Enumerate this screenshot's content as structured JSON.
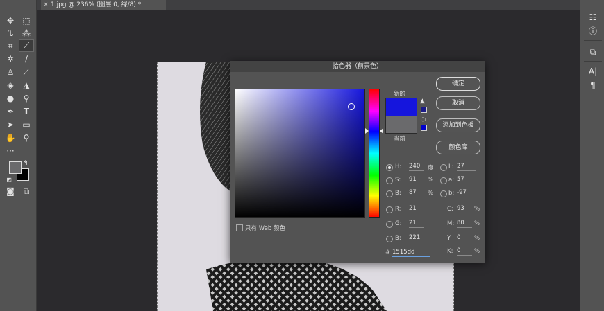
{
  "document_tab": {
    "title": "1.jpg @ 236% (图层 0, 绿/8) *",
    "close_glyph": "×"
  },
  "dialog": {
    "title": "拾色器（前景色）",
    "new_label": "新的",
    "current_label": "当前",
    "buttons": {
      "ok": "确定",
      "cancel": "取消",
      "add_swatch": "添加到色板",
      "libraries": "颜色库"
    },
    "web_only_label": "只有 Web 颜色",
    "new_color": "#1515dd",
    "current_color": "#6a6a6c",
    "hsb": {
      "h": {
        "label": "H:",
        "value": "240",
        "unit": "度"
      },
      "s": {
        "label": "S:",
        "value": "91",
        "unit": "%"
      },
      "b": {
        "label": "B:",
        "value": "87",
        "unit": "%"
      }
    },
    "rgb": {
      "r": {
        "label": "R:",
        "value": "21"
      },
      "g": {
        "label": "G:",
        "value": "21"
      },
      "b": {
        "label": "B:",
        "value": "221"
      }
    },
    "lab": {
      "l": {
        "label": "L:",
        "value": "27"
      },
      "a": {
        "label": "a:",
        "value": "57"
      },
      "b": {
        "label": "b:",
        "value": "-97"
      }
    },
    "cmyk": {
      "c": {
        "label": "C:",
        "value": "93",
        "unit": "%"
      },
      "m": {
        "label": "M:",
        "value": "80",
        "unit": "%"
      },
      "y": {
        "label": "Y:",
        "value": "0",
        "unit": "%"
      },
      "k": {
        "label": "K:",
        "value": "0",
        "unit": "%"
      }
    },
    "hex": {
      "label": "#",
      "value": "1515dd"
    }
  },
  "toolbar": {
    "tools": [
      "move-icon",
      "artboard-icon",
      "lasso-icon",
      "magic-wand-icon",
      "crop-icon",
      "eyedropper-icon",
      "healing-icon",
      "brush-icon",
      "stamp-icon",
      "history-brush-icon",
      "eraser-icon",
      "paint-bucket-icon",
      "blur-icon",
      "dodge-icon",
      "pen-icon",
      "text-icon",
      "path-select-icon",
      "rectangle-icon",
      "hand-icon",
      "zoom-icon",
      "more-icon"
    ],
    "foreground": "#6a6a6c",
    "background": "#000000"
  },
  "right_panel": {
    "icons": [
      "libraries-icon",
      "info-icon",
      "character-icon",
      "type-icon",
      "paragraph-icon"
    ]
  }
}
